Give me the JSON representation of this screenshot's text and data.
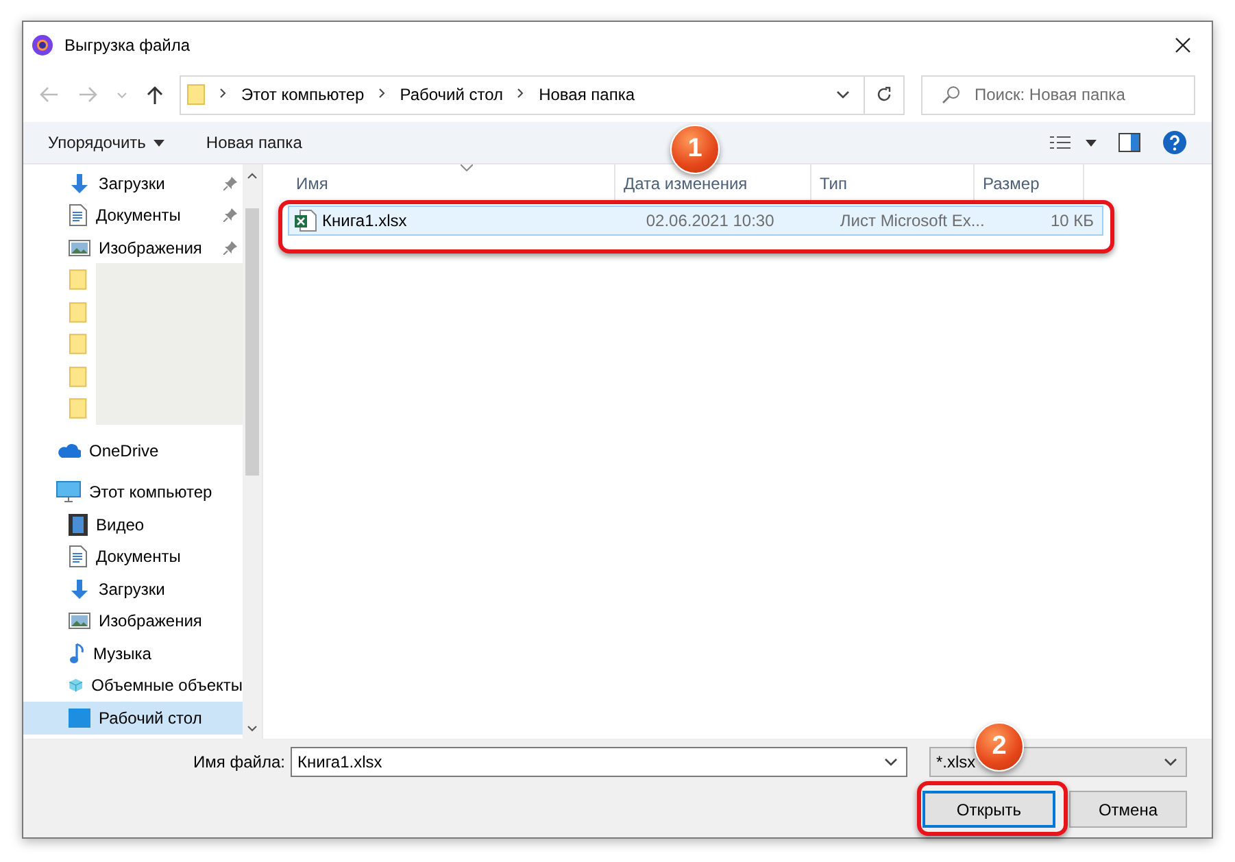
{
  "window": {
    "title": "Выгрузка файла"
  },
  "address": {
    "crumbs": [
      "Этот компьютер",
      "Рабочий стол",
      "Новая папка"
    ],
    "search_placeholder": "Поиск: Новая папка"
  },
  "toolbar": {
    "organize": "Упорядочить",
    "new_folder": "Новая папка"
  },
  "sidebar": {
    "quick_access": [
      {
        "kind": "download",
        "label": "Загрузки",
        "pinned": true,
        "selected": false
      },
      {
        "kind": "document",
        "label": "Документы",
        "pinned": true,
        "selected": false
      },
      {
        "kind": "pictures",
        "label": "Изображения",
        "pinned": true,
        "selected": false
      },
      {
        "kind": "hidden-folder",
        "selected": false
      },
      {
        "kind": "hidden-folder",
        "selected": false
      },
      {
        "kind": "hidden-folder",
        "selected": false
      },
      {
        "kind": "hidden-folder",
        "selected": false
      },
      {
        "kind": "hidden-folder",
        "selected": false
      }
    ],
    "items": [
      {
        "kind": "onedrive",
        "label": "OneDrive",
        "selected": false
      },
      {
        "kind": "computer",
        "label": "Этот компьютер",
        "selected": false,
        "children": [
          {
            "kind": "video",
            "label": "Видео",
            "selected": false
          },
          {
            "kind": "document",
            "label": "Документы",
            "selected": false
          },
          {
            "kind": "download",
            "label": "Загрузки",
            "selected": false
          },
          {
            "kind": "pictures",
            "label": "Изображения",
            "selected": false
          },
          {
            "kind": "music",
            "label": "Музыка",
            "selected": false
          },
          {
            "kind": "objects",
            "label": "Объемные объекты",
            "selected": false
          },
          {
            "kind": "desktop",
            "label": "Рабочий стол",
            "selected": true
          }
        ]
      }
    ]
  },
  "table": {
    "columns": [
      "Имя",
      "Дата изменения",
      "Тип",
      "Размер"
    ],
    "rows": [
      {
        "name": "Книга1.xlsx",
        "date": "02.06.2021 10:30",
        "type": "Лист Microsoft Ex...",
        "size": "10 КБ",
        "selected": true
      }
    ]
  },
  "footer": {
    "filename_label": "Имя файла:",
    "filename": "Книга1.xlsx",
    "filter": "*.xlsx",
    "open": "Открыть",
    "cancel": "Отмена"
  },
  "annotations": [
    {
      "label": "1"
    },
    {
      "label": "2"
    }
  ]
}
